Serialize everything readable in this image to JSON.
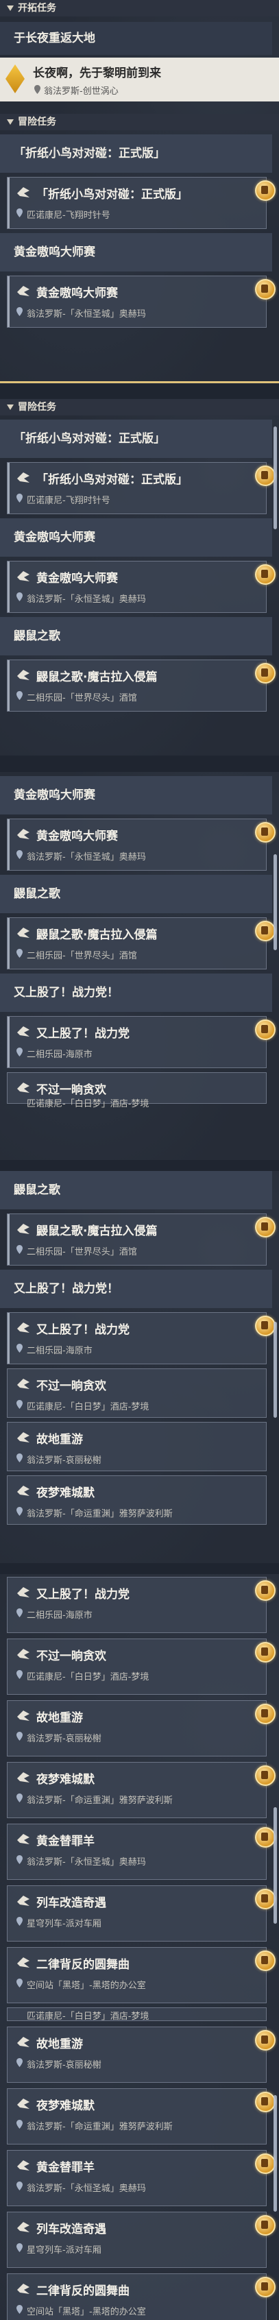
{
  "headers": {
    "explore": "开拓任务",
    "adventure": "冒险任务"
  },
  "explore": {
    "card_title": "于长夜重返大地",
    "quest_title": "长夜啊，先于黎明前到来",
    "quest_location": "翁法罗斯-创世涡心"
  },
  "panel1": {
    "items": [
      {
        "card": "「折纸小鸟对对碰：正式版」",
        "quest": "「折纸小鸟对对碰：正式版」",
        "loc": "匹诺康尼-飞翔时针号"
      },
      {
        "card": "黄金嗷呜大师赛",
        "quest": "黄金嗷呜大师赛",
        "loc": "翁法罗斯-「永恒圣城」奥赫玛"
      }
    ]
  },
  "panel2": {
    "items": [
      {
        "card": "「折纸小鸟对对碰：正式版」",
        "quest": "「折纸小鸟对对碰：正式版」",
        "loc": "匹诺康尼-飞翔时针号"
      },
      {
        "card": "黄金嗷呜大师赛",
        "quest": "黄金嗷呜大师赛",
        "loc": "翁法罗斯-「永恒圣城」奥赫玛"
      },
      {
        "card": "鼹鼠之歌",
        "quest": "鼹鼠之歌·魔古拉入侵篇",
        "loc": "二相乐园-「世界尽头」酒馆"
      }
    ]
  },
  "panel3": {
    "items": [
      {
        "card": "黄金嗷呜大师赛",
        "quest": "黄金嗷呜大师赛",
        "loc": "翁法罗斯-「永恒圣城」奥赫玛"
      },
      {
        "card": "鼹鼠之歌",
        "quest": "鼹鼠之歌·魔古拉入侵篇",
        "loc": "二相乐园-「世界尽头」酒馆"
      },
      {
        "card": "又上股了！战力党！",
        "quest": "又上股了！战力党",
        "loc": "二相乐园-海原市"
      }
    ],
    "tail_quest": "不过一晌贪欢",
    "tail_loc": "匹诺康尼-「白日梦」酒店-梦境"
  },
  "panel4": {
    "items": [
      {
        "card": "鼹鼠之歌",
        "quest": "鼹鼠之歌·魔古拉入侵篇",
        "loc": "二相乐园-「世界尽头」酒馆"
      },
      {
        "card": "又上股了！战力党！",
        "quest": "又上股了！战力党",
        "loc": "二相乐园-海原市"
      }
    ],
    "plain": [
      {
        "quest": "不过一晌贪欢",
        "loc": "匹诺康尼-「白日梦」酒店-梦境"
      },
      {
        "quest": "故地重游",
        "loc": "翁法罗斯-哀丽秘榭"
      },
      {
        "quest": "夜梦难城默",
        "loc": "翁法罗斯-「命运重渊」雅努萨波利斯"
      }
    ]
  },
  "panel5": {
    "plain": [
      {
        "quest": "又上股了！战力党",
        "loc": "二相乐园-海原市"
      },
      {
        "quest": "不过一晌贪欢",
        "loc": "匹诺康尼-「白日梦」酒店-梦境"
      },
      {
        "quest": "故地重游",
        "loc": "翁法罗斯-哀丽秘榭"
      },
      {
        "quest": "夜梦难城默",
        "loc": "翁法罗斯-「命运重渊」雅努萨波利斯"
      },
      {
        "quest": "黄金替罪羊",
        "loc": "翁法罗斯-「永恒圣城」奥赫玛"
      },
      {
        "quest": "列车改造奇遇",
        "loc": "星穹列车-派对车厢"
      },
      {
        "quest": "二律背反的圆舞曲",
        "loc": "空间站「黑塔」-黑塔的办公室"
      },
      {
        "quest": "故地重游",
        "loc": "翁法罗斯-哀丽秘榭"
      },
      {
        "quest": "夜梦难城默",
        "loc": "翁法罗斯-「命运重渊」雅努萨波利斯"
      },
      {
        "quest": "黄金替罪羊",
        "loc": "翁法罗斯-「永恒圣城」奥赫玛"
      },
      {
        "quest": "列车改造奇遇",
        "loc": "星穹列车-派对车厢"
      },
      {
        "quest": "二律背反的圆舞曲",
        "loc": "空间站「黑塔」-黑塔的办公室"
      }
    ],
    "partial_loc": "匹诺康尼-「白日梦」酒店-梦境"
  }
}
